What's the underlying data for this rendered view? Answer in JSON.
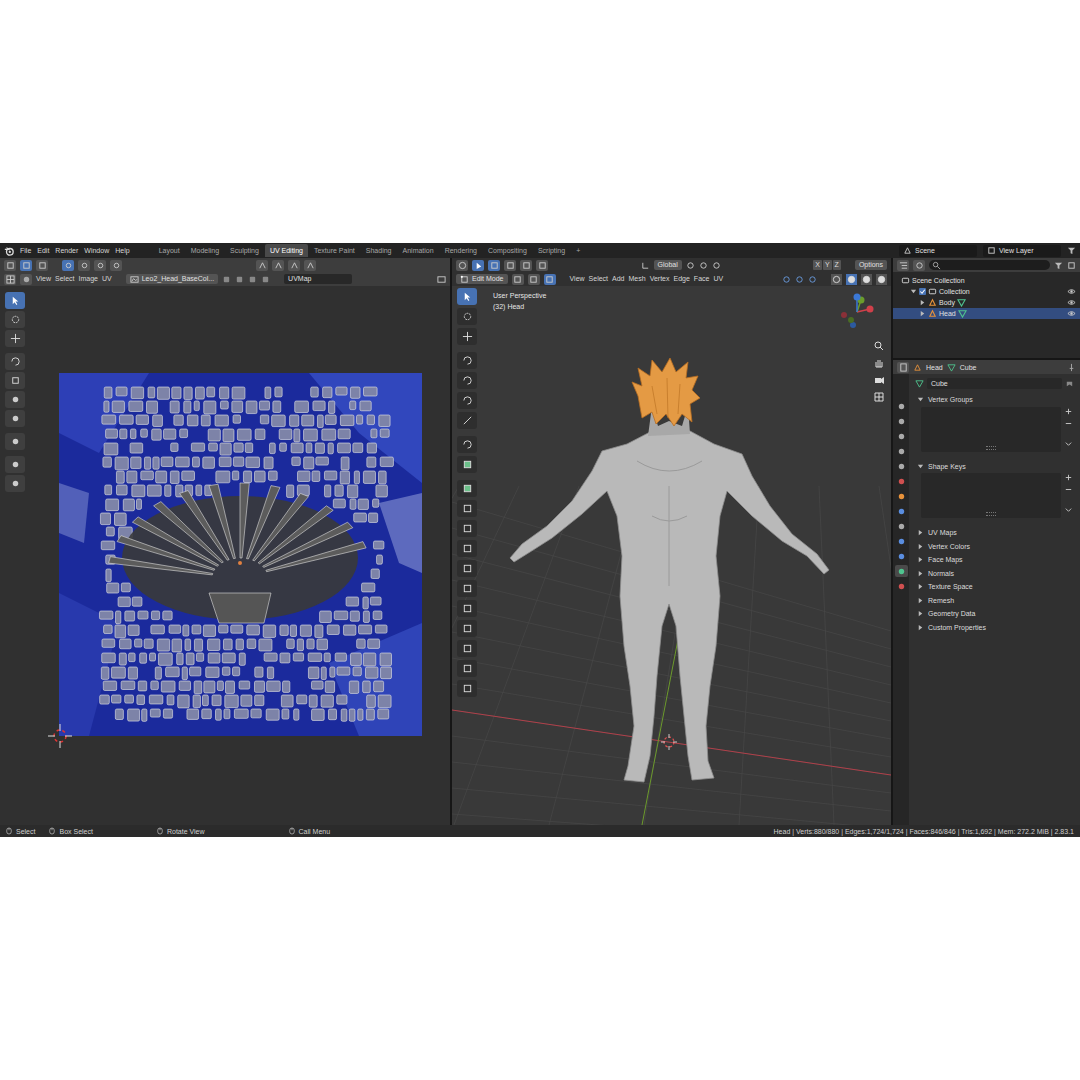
{
  "topbar": {
    "menu": [
      "File",
      "Edit",
      "Render",
      "Window",
      "Help"
    ],
    "workspaces": [
      {
        "label": "Layout",
        "selected": false
      },
      {
        "label": "Modeling",
        "selected": false
      },
      {
        "label": "Sculpting",
        "selected": false
      },
      {
        "label": "UV Editing",
        "selected": true
      },
      {
        "label": "Texture Paint",
        "selected": false
      },
      {
        "label": "Shading",
        "selected": false
      },
      {
        "label": "Animation",
        "selected": false
      },
      {
        "label": "Rendering",
        "selected": false
      },
      {
        "label": "Compositing",
        "selected": false
      },
      {
        "label": "Scripting",
        "selected": false
      }
    ],
    "add_workspace": "+",
    "scene": "Scene",
    "view_layer": "View Layer"
  },
  "uv_editor": {
    "menu": [
      "View",
      "Select",
      "Image",
      "UV"
    ],
    "image": "Leo2_Head_BaseCol...",
    "uv_map": "UVMap"
  },
  "viewport": {
    "mode": "Edit Mode",
    "menu": [
      "View",
      "Select",
      "Add",
      "Mesh",
      "Vertex",
      "Edge",
      "Face",
      "UV"
    ],
    "orientation": "Global",
    "mirror_axes": [
      {
        "label": "X",
        "selected": false
      },
      {
        "label": "Y",
        "selected": false
      },
      {
        "label": "Z",
        "selected": false
      }
    ],
    "options": "Options",
    "view_name": "User Perspective",
    "object_info": "(32) Head"
  },
  "outliner": {
    "items": [
      {
        "label": "Scene Collection",
        "kind": "scene",
        "expanded": true,
        "selected": false
      },
      {
        "label": "Collection",
        "kind": "collection",
        "expanded": true,
        "selected": false,
        "checked": true
      },
      {
        "label": "Body",
        "kind": "object",
        "expanded": false,
        "selected": false
      },
      {
        "label": "Head",
        "kind": "object",
        "expanded": false,
        "selected": true
      }
    ]
  },
  "properties": {
    "object": "Head",
    "data": "Cube",
    "name": "Cube",
    "panels": [
      {
        "label": "Vertex Groups",
        "expanded": true
      },
      {
        "label": "Shape Keys",
        "expanded": true
      },
      {
        "label": "UV Maps",
        "expanded": false
      },
      {
        "label": "Vertex Colors",
        "expanded": false
      },
      {
        "label": "Face Maps",
        "expanded": false
      },
      {
        "label": "Normals",
        "expanded": false
      },
      {
        "label": "Texture Space",
        "expanded": false
      },
      {
        "label": "Remesh",
        "expanded": false
      },
      {
        "label": "Geometry Data",
        "expanded": false
      },
      {
        "label": "Custom Properties",
        "expanded": false
      }
    ]
  },
  "status_bar": {
    "hints": [
      "Select",
      "Box Select",
      "Rotate View",
      "Call Menu"
    ],
    "stats": "Head | Verts:880/880 | Edges:1,724/1,724 | Faces:846/846 | Tris:1,692 | Mem: 272.2 MiB | 2.83.1"
  }
}
